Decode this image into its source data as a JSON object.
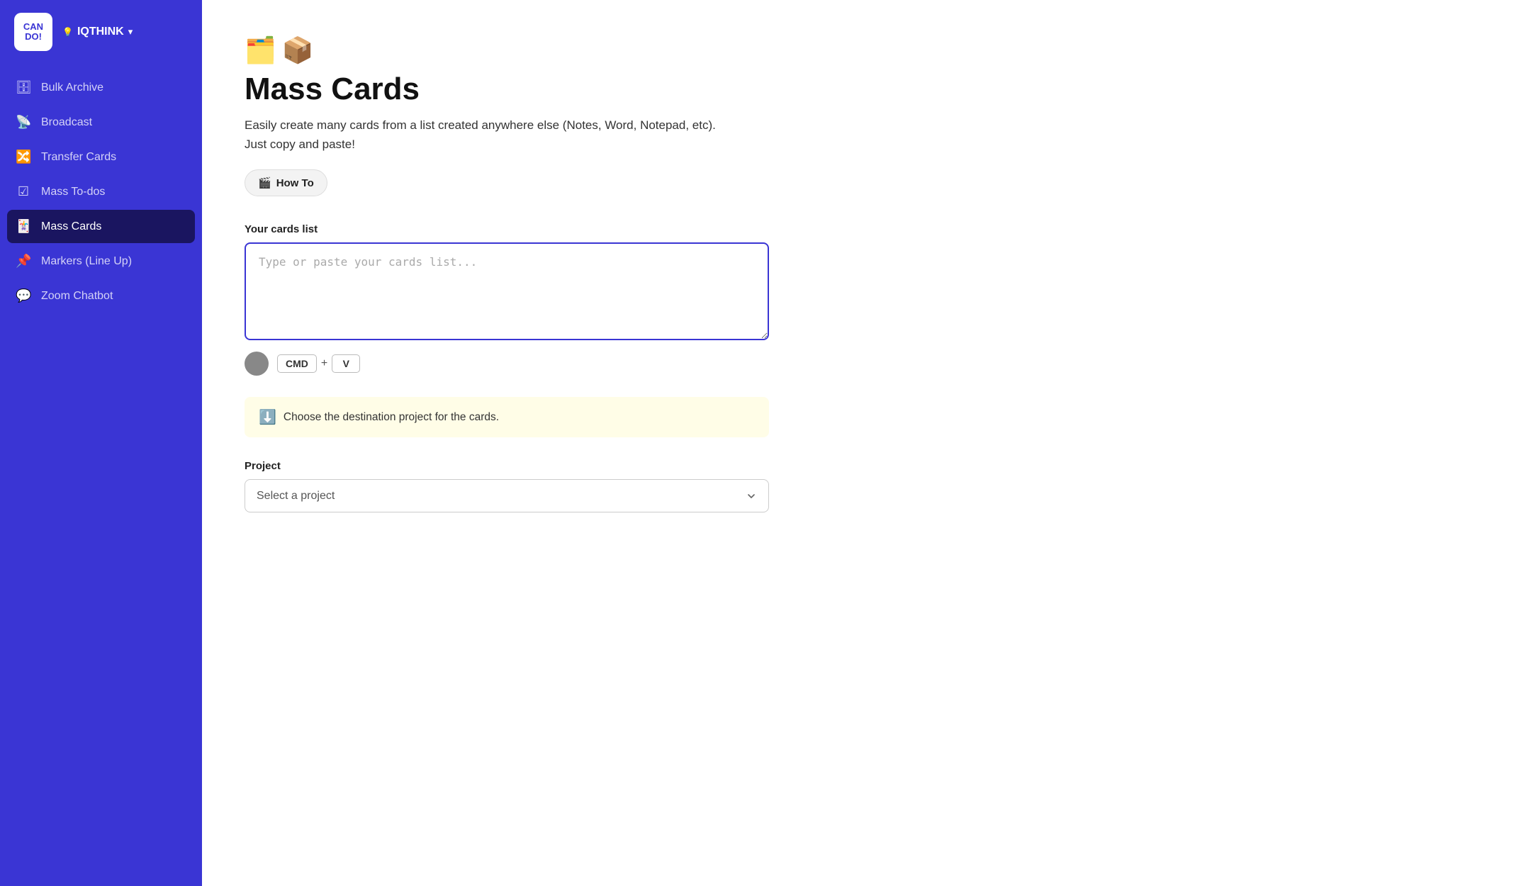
{
  "app": {
    "logo_line1": "CAN",
    "logo_line2": "DO!"
  },
  "workspace": {
    "icon": "💡",
    "name": "IQTHINK",
    "chevron": "▾"
  },
  "sidebar": {
    "items": [
      {
        "id": "bulk-archive",
        "label": "Bulk Archive",
        "icon": "🗄"
      },
      {
        "id": "broadcast",
        "label": "Broadcast",
        "icon": "📡"
      },
      {
        "id": "transfer-cards",
        "label": "Transfer Cards",
        "icon": "🔀"
      },
      {
        "id": "mass-todos",
        "label": "Mass To-dos",
        "icon": "☑"
      },
      {
        "id": "mass-cards",
        "label": "Mass Cards",
        "icon": "🃏",
        "active": true
      },
      {
        "id": "markers",
        "label": "Markers (Line Up)",
        "icon": "📌"
      },
      {
        "id": "zoom-chatbot",
        "label": "Zoom Chatbot",
        "icon": "💬"
      }
    ]
  },
  "main": {
    "page_icon1": "🗂️",
    "page_icon2": "📦",
    "title": "Mass Cards",
    "description": "Easily create many cards from a list created anywhere else (Notes, Word, Notepad, etc). Just copy and paste!",
    "how_to_btn": {
      "icon": "🎬",
      "label": "How To"
    },
    "cards_list": {
      "label": "Your cards list",
      "placeholder": "Type or paste your cards list..."
    },
    "paste_hint": {
      "cmd_key": "CMD",
      "plus": "+",
      "v_key": "V"
    },
    "info_banner": {
      "icon": "⬇️",
      "text": "Choose the destination project for the cards."
    },
    "project": {
      "label": "Project",
      "placeholder": "Select a project",
      "options": [
        {
          "value": "",
          "label": "Select a project"
        }
      ]
    }
  }
}
